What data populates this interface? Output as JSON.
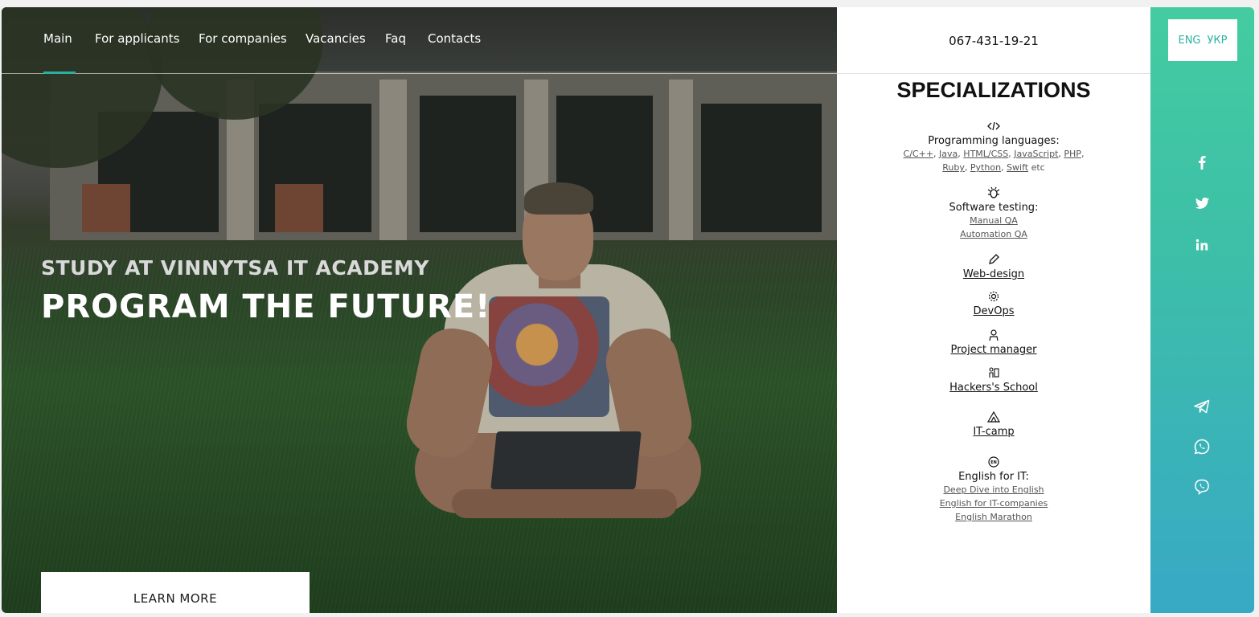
{
  "nav": {
    "items": [
      {
        "label": "Main",
        "active": true
      },
      {
        "label": "For applicants"
      },
      {
        "label": "For companies"
      },
      {
        "label": "Vacancies"
      },
      {
        "label": "Faq"
      },
      {
        "label": "Contacts"
      }
    ]
  },
  "hero": {
    "subtitle": "STUDY AT VINNYTSA IT ACADEMY",
    "title": "PROGRAM THE FUTURE!",
    "button_label": "LEARN MORE"
  },
  "header": {
    "phone": "067-431-19-21"
  },
  "specializations": {
    "title": "SPECIALIZATIONS",
    "programming": {
      "icon": "code-icon",
      "label": "Programming languages:",
      "links": [
        "C/C++",
        "Java",
        "HTML/CSS",
        "JavaScript",
        "PHP",
        "Ruby",
        "Python",
        "Swift"
      ],
      "suffix": "etc"
    },
    "testing": {
      "icon": "bug-icon",
      "label": "Software testing:",
      "links": [
        "Manual QA",
        "Automation QA"
      ]
    },
    "webdesign": {
      "icon": "pencil-icon",
      "label": "Web-design"
    },
    "devops": {
      "icon": "gear-icon",
      "label": "DevOps"
    },
    "pm": {
      "icon": "person-icon",
      "label": "Project manager"
    },
    "hackers": {
      "icon": "people-icon",
      "label": "Hackers's School"
    },
    "itcamp": {
      "icon": "tent-icon",
      "label": "IT-camp"
    },
    "english": {
      "icon": "en-icon",
      "label": "English for IT:",
      "links": [
        "Deep Dive into English",
        "English for IT-companies",
        "English Marathon"
      ]
    }
  },
  "languages": {
    "eng": "ENG",
    "ukr": "УКР"
  },
  "colors": {
    "accent": "#2bb0a0",
    "sidebar_top": "#44cca0",
    "sidebar_bottom": "#38a9c5"
  },
  "social": [
    "facebook-icon",
    "twitter-icon",
    "linkedin-icon",
    "telegram-icon",
    "whatsapp-icon",
    "viber-icon"
  ]
}
